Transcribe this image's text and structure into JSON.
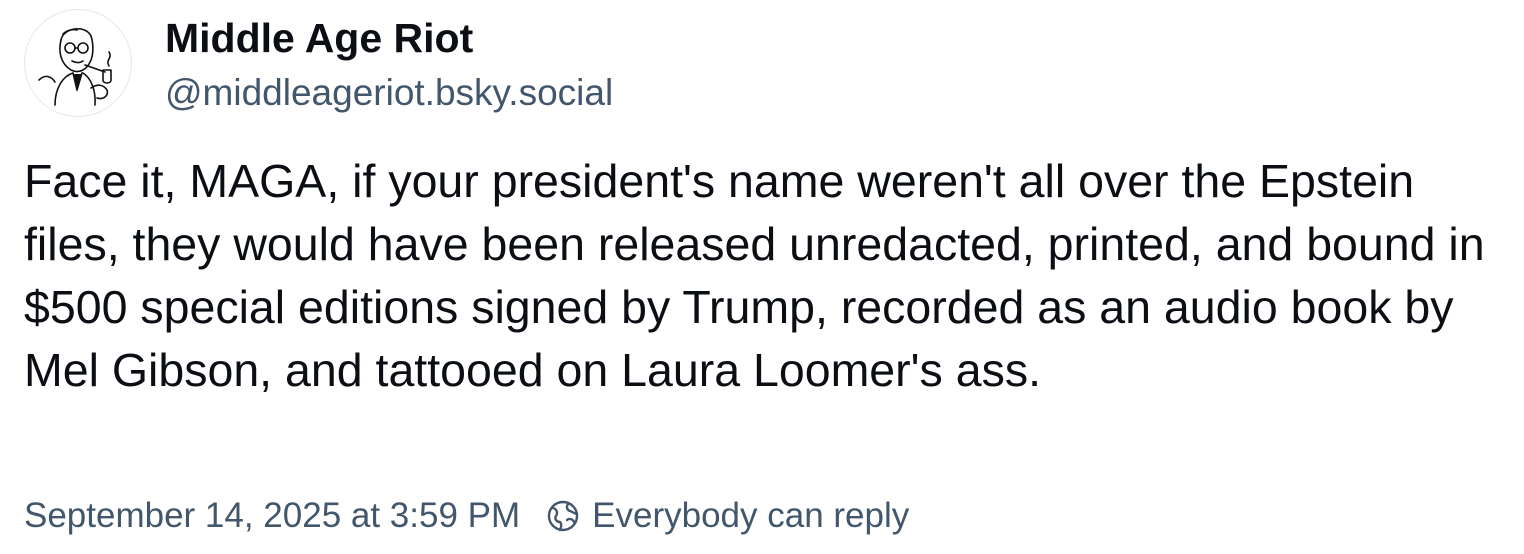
{
  "author": {
    "display_name": "Middle Age Riot",
    "handle": "@middleageriot.bsky.social",
    "avatar_icon": "vintage-man-with-pipe-avatar"
  },
  "post": {
    "text": "Face it, MAGA, if your president's name weren't all over the Epstein files, they would have been released unredacted, printed, and bound in $500 special editions signed by Trump, recorded as an audio book by Mel Gibson, and tattooed on Laura Loomer's ass."
  },
  "meta": {
    "timestamp": "September 14, 2025 at 3:59 PM",
    "reply_setting_icon": "globe-icon",
    "reply_setting": "Everybody can reply"
  },
  "colors": {
    "text_primary": "#0b0f14",
    "text_secondary": "#42576c",
    "background": "#ffffff"
  }
}
